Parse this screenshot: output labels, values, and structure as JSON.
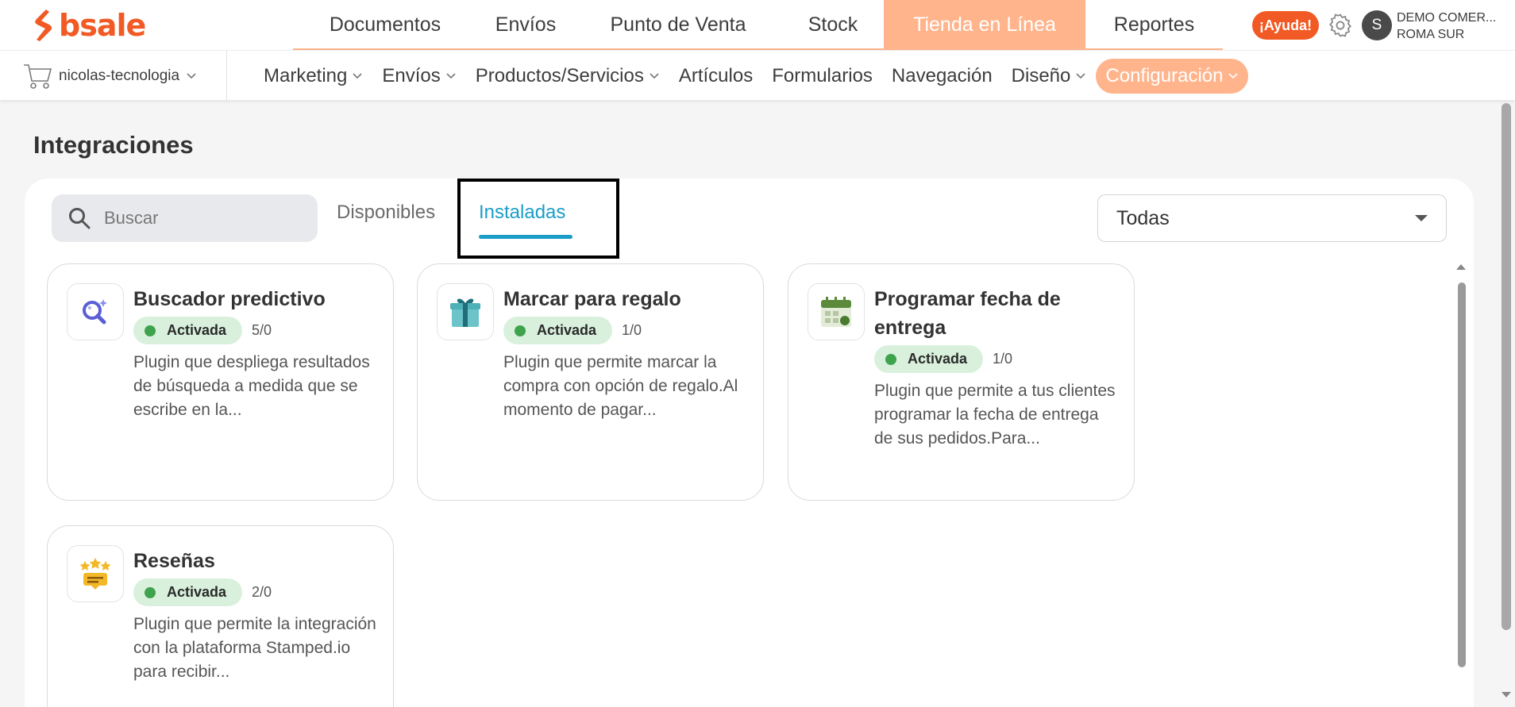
{
  "brand": {
    "name": "bsale",
    "color": "#f15a24"
  },
  "main_nav": {
    "tabs": [
      {
        "label": "Documentos"
      },
      {
        "label": "Envíos"
      },
      {
        "label": "Punto de Venta"
      },
      {
        "label": "Stock"
      },
      {
        "label": "Tienda en Línea",
        "active": true
      },
      {
        "label": "Reportes"
      }
    ],
    "accent_color": "#ffb48c"
  },
  "header": {
    "help_label": "¡Ayuda!",
    "settings_icon": "gear-icon",
    "avatar_letter": "S",
    "company_line1": "DEMO COMER...",
    "company_line2": "ROMA SUR"
  },
  "store": {
    "name": "nicolas-tecnologia",
    "icon": "cart-icon"
  },
  "sub_nav": {
    "items": [
      {
        "label": "Marketing",
        "dropdown": true
      },
      {
        "label": "Envíos",
        "dropdown": true
      },
      {
        "label": "Productos/Servicios",
        "dropdown": true
      },
      {
        "label": "Artículos",
        "dropdown": false
      },
      {
        "label": "Formularios",
        "dropdown": false
      },
      {
        "label": "Navegación",
        "dropdown": false
      },
      {
        "label": "Diseño",
        "dropdown": true
      },
      {
        "label": "Configuración",
        "dropdown": true,
        "active": true
      }
    ]
  },
  "page": {
    "title": "Integraciones"
  },
  "search": {
    "placeholder": "Buscar",
    "value": ""
  },
  "filter_tabs": {
    "available_label": "Disponibles",
    "installed_label": "Instaladas",
    "active": "Instaladas",
    "active_color": "#1b9dc8"
  },
  "category_select": {
    "value": "Todas"
  },
  "plugins": [
    {
      "title": "Buscador predictivo",
      "status": "Activada",
      "count": "5/0",
      "description": "Plugin que despliega resultados de búsqueda a medida que se escribe en la...",
      "icon": "search-magnifier-icon"
    },
    {
      "title": "Marcar para regalo",
      "status": "Activada",
      "count": "1/0",
      "description": "Plugin que permite marcar la compra con opción de regalo.Al momento de pagar...",
      "icon": "gift-icon"
    },
    {
      "title": "Programar fecha de entrega",
      "status": "Activada",
      "count": "1/0",
      "description": "Plugin que permite a tus clientes programar la fecha de entrega de sus pedidos.Para...",
      "icon": "calendar-icon"
    },
    {
      "title": "Reseñas",
      "status": "Activada",
      "count": "2/0",
      "description": "Plugin que permite la integración con la plataforma Stamped.io para recibir...",
      "icon": "review-stars-icon"
    }
  ],
  "status_color": "#3fa34d"
}
